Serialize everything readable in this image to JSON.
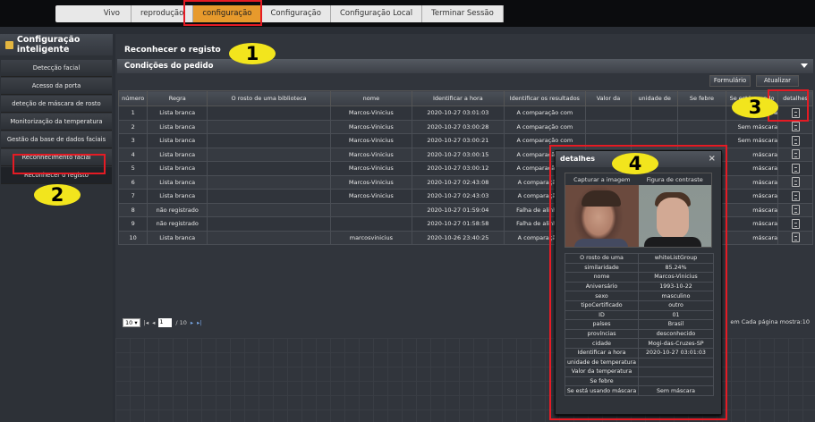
{
  "topnav": {
    "items": [
      "Vivo",
      "reprodução",
      "configuração",
      "Configuração",
      "Configuração Local",
      "Terminar Sessão"
    ]
  },
  "sidebar": {
    "title": "Configuração inteligente",
    "items": [
      {
        "label": "Detecção facial"
      },
      {
        "label": "Acesso da porta"
      },
      {
        "label": "deteção de máscara de rosto"
      },
      {
        "label": "Monitorização da temperatura"
      },
      {
        "label": "Gestão da base de dados faciais"
      },
      {
        "label": "Reconhecimento facial"
      },
      {
        "label": "Reconhecer o registo"
      }
    ]
  },
  "main": {
    "title": "Reconhecer o registo",
    "conditions": "Condições do pedido",
    "form_button": "Formulário",
    "refresh_button": "Atualizar"
  },
  "table": {
    "headers": [
      "número",
      "Regra",
      "O rosto de uma biblioteca",
      "nome",
      "Identificar a hora",
      "Identificar os resultados",
      "Valor da",
      "unidade de",
      "Se febre",
      "Se está usando",
      "detalhes"
    ],
    "rows": [
      [
        "1",
        "Lista branca",
        "",
        "Marcos-Vinicius",
        "2020-10-27 03:01:03",
        "A comparação com",
        "",
        "",
        "",
        "Sem máscara"
      ],
      [
        "2",
        "Lista branca",
        "",
        "Marcos-Vinicius",
        "2020-10-27 03:00:28",
        "A comparação com",
        "",
        "",
        "",
        "Sem máscara"
      ],
      [
        "3",
        "Lista branca",
        "",
        "Marcos-Vinicius",
        "2020-10-27 03:00:21",
        "A comparação com",
        "",
        "",
        "",
        "Sem máscara"
      ],
      [
        "4",
        "Lista branca",
        "",
        "Marcos-Vinicius",
        "2020-10-27 03:00:15",
        "A comparação com",
        "",
        "",
        "",
        "máscara"
      ],
      [
        "5",
        "Lista branca",
        "",
        "Marcos-Vinicius",
        "2020-10-27 03:00:12",
        "A comparação com",
        "",
        "",
        "",
        "máscara"
      ],
      [
        "6",
        "Lista branca",
        "",
        "Marcos-Vinicius",
        "2020-10-27 02:43:08",
        "A comparação con",
        "",
        "",
        "",
        "máscara"
      ],
      [
        "7",
        "Lista branca",
        "",
        "Marcos-Vinicius",
        "2020-10-27 02:43:03",
        "A comparação con",
        "",
        "",
        "",
        "máscara"
      ],
      [
        "8",
        "não registrado",
        "",
        "",
        "2020-10-27 01:59:04",
        "Falha de alinhamen",
        "",
        "",
        "",
        "máscara"
      ],
      [
        "9",
        "não registrado",
        "",
        "",
        "2020-10-27 01:58:58",
        "Falha de alinhamen",
        "",
        "",
        "",
        "máscara"
      ],
      [
        "10",
        "Lista branca",
        "",
        "marcosvinicius",
        "2020-10-26 23:40:25",
        "A comparação con",
        "",
        "",
        "",
        "máscara"
      ]
    ]
  },
  "pager": {
    "page_size": "10",
    "current_page": "1",
    "total_pages": "/ 10",
    "per_page_text": "em Cada página mostra:10"
  },
  "popup": {
    "title": "detalhes",
    "close": "×",
    "col1": "Capturar a imagem",
    "col2": "Figura de contraste",
    "rows": [
      [
        "O rosto de uma",
        "whiteListGroup"
      ],
      [
        "similaridade",
        "85.24%"
      ],
      [
        "nome",
        "Marcos-Vinicius"
      ],
      [
        "Aniversário",
        "1993-10-22"
      ],
      [
        "sexo",
        "masculino"
      ],
      [
        "tipoCertificado",
        "outro"
      ],
      [
        "ID",
        "01"
      ],
      [
        "países",
        "Brasil"
      ],
      [
        "províncias",
        "desconhecido"
      ],
      [
        "cidade",
        "Mogi-das-Cruzes-SP"
      ],
      [
        "Identificar a hora",
        "2020-10-27 03:01:03"
      ],
      [
        "unidade de temperatura",
        ""
      ],
      [
        "Valor da temperatura",
        ""
      ],
      [
        "Se febre",
        ""
      ],
      [
        "Se está usando máscara",
        "Sem máscara"
      ]
    ]
  },
  "annotations": [
    "1",
    "2",
    "3",
    "4"
  ],
  "colors": {
    "accent": "#e79a2c",
    "highlight": "#e51b24",
    "badge": "#f2e51d"
  }
}
